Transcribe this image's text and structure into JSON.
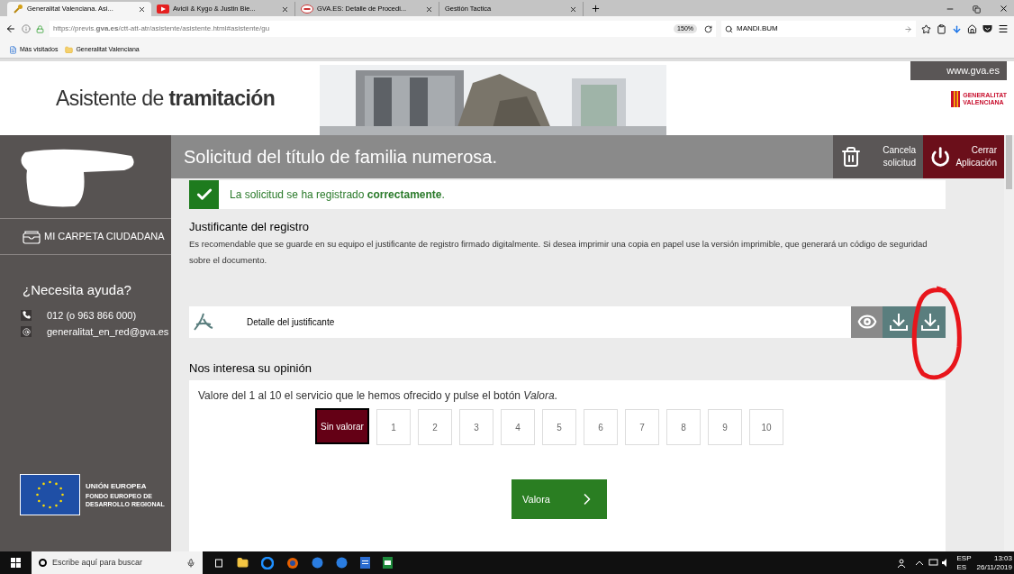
{
  "browser": {
    "tabs": [
      {
        "title": "Generalitat Valenciana. Asi...",
        "kind": "key",
        "selected": true
      },
      {
        "title": "Avicii & Kygo & Justin Bie...",
        "kind": "video",
        "selected": false
      },
      {
        "title": "GVA.ES: Detalle de Procedi...",
        "kind": "gva",
        "selected": false
      },
      {
        "title": "Gestión Tactica",
        "kind": "plain",
        "selected": false
      }
    ],
    "url": "https://previs.**gva.es**/ctt-att-atr/asistente/asistente.html#asistente/gu",
    "zoom": "150%",
    "search": "MANDI.BUM",
    "bookmarks": [
      {
        "label": "Más visitados",
        "kind": "page"
      },
      {
        "label": "Generalitat Valenciana",
        "kind": "folder"
      }
    ]
  },
  "header": {
    "title": "Asistente de **tramitación**",
    "site": "www.gva.es",
    "logo_lines": [
      "GENERALITAT",
      "VALENCIANA"
    ]
  },
  "sidebar": {
    "menu_item": "MI CARPETA CIUDADANA",
    "help_title": "¿Necesita ayuda?",
    "contacts": [
      {
        "kind": "phone",
        "text": "012 (o 963 866 000)"
      },
      {
        "kind": "email",
        "text": "generalitat_en_red@gva.es"
      }
    ],
    "eu": {
      "title": "UNIÓN EUROPEA",
      "lines": [
        "FONDO EUROPEO DE",
        "DESARROLLO REGIONAL"
      ]
    }
  },
  "main": {
    "title": "Solicitud del título de familia numerosa.",
    "actions": [
      {
        "kind": "trash",
        "lines": [
          "Cancela",
          "solicitud"
        ]
      },
      {
        "kind": "power",
        "lines": [
          "Cerrar",
          "Aplicación"
        ]
      }
    ],
    "success": "La solicitud se ha registrado **correctamente**.",
    "receipt": {
      "heading": "Justificante del registro",
      "description": "Es recomendable que se guarde en su equipo el justificante de registro firmado digitalmente. Si desea imprimir una copia en papel use la versión imprimible, que generará un código de seguridad sobre el documento.",
      "document": "Detalle del justificante",
      "tools": [
        {
          "kind": "view"
        },
        {
          "kind": "download"
        },
        {
          "kind": "download"
        }
      ]
    },
    "opinion": {
      "heading": "Nos interesa su opinión",
      "prompt": "Valore del 1 al 10 el servicio que le hemos ofrecido y pulse el botón *Valora*.",
      "options": [
        {
          "label": "Sin valorar",
          "selected": true
        },
        {
          "label": "1",
          "selected": false
        },
        {
          "label": "2",
          "selected": false
        },
        {
          "label": "3",
          "selected": false
        },
        {
          "label": "4",
          "selected": false
        },
        {
          "label": "5",
          "selected": false
        },
        {
          "label": "6",
          "selected": false
        },
        {
          "label": "7",
          "selected": false
        },
        {
          "label": "8",
          "selected": false
        },
        {
          "label": "9",
          "selected": false
        },
        {
          "label": "10",
          "selected": false
        }
      ],
      "submit": "Valora"
    }
  },
  "taskbar": {
    "search": "Escribe aquí para buscar",
    "lang": [
      "ESP",
      "ES"
    ],
    "time": "13:03",
    "date": "26/11/2019"
  }
}
